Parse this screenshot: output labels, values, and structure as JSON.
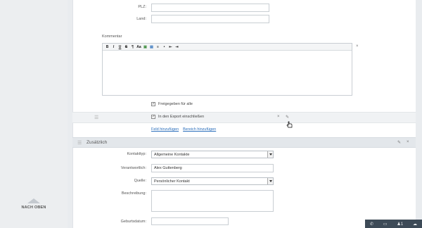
{
  "sidebar": {
    "back_to_top": "NACH OBEN"
  },
  "address": {
    "plz_label": "PLZ:",
    "land_label": "Land:",
    "plz_value": "",
    "land_value": ""
  },
  "comment": {
    "label": "Kommentar",
    "toolbar": [
      "B",
      "I",
      "U",
      "S",
      "¶",
      "Aa",
      "▣",
      "▤",
      "≡",
      "•",
      "⇤",
      "⇥"
    ],
    "remove": "×"
  },
  "sharing": {
    "share_all_label": "Freigegeben für alle",
    "export_label": "In den Export einschließen",
    "export_remove": "×"
  },
  "actions": {
    "add_field": "Feld hinzufügen",
    "add_section": "Bereich hinzufügen"
  },
  "section": {
    "title": "Zusätzlich"
  },
  "form": {
    "contact_type_label": "Kontakttyp:",
    "contact_type_value": "Allgemeine Kontakte",
    "responsible_label": "Verantwortlich:",
    "responsible_value": "Alex Guttenberg",
    "source_label": "Quelle:",
    "source_value": "Persönlicher Kontakt",
    "description_label": "Beschreibung:",
    "birthdate_label": "Geburtsdatum:"
  },
  "taskbar": {
    "badge": "1"
  }
}
